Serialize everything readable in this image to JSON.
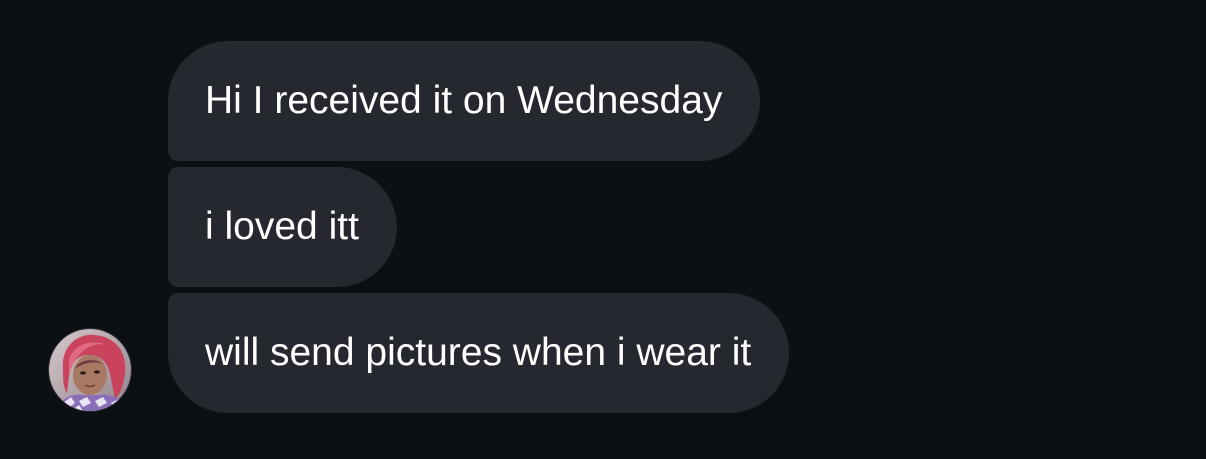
{
  "messages": [
    {
      "text": "Hi I received it on Wednesday"
    },
    {
      "text": "i loved itt"
    },
    {
      "text": "will send pictures when i wear it"
    }
  ],
  "avatar": {
    "icon": "profile-photo"
  },
  "colors": {
    "background": "#0c0f14",
    "bubble": "#25282e",
    "text": "#ffffff"
  }
}
